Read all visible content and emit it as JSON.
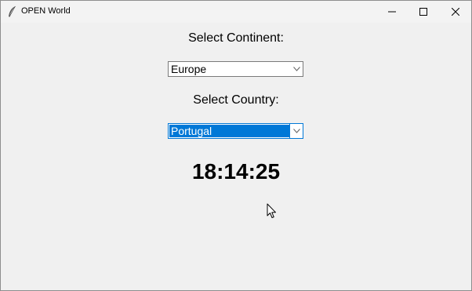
{
  "window": {
    "title": "OPEN World",
    "app_icon": "feather-icon",
    "controls": {
      "minimize_icon": "minimize-icon",
      "maximize_icon": "maximize-icon",
      "close_icon": "close-icon"
    }
  },
  "continent": {
    "label": "Select Continent:",
    "selected": "Europe"
  },
  "country": {
    "label": "Select Country:",
    "selected": "Portugal"
  },
  "clock": {
    "time": "18:14:25"
  },
  "colors": {
    "selection_highlight": "#0078d7",
    "window_background": "#f0f0f0"
  }
}
